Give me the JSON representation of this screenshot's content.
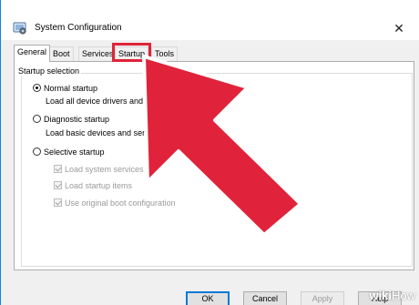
{
  "window": {
    "title": "System Configuration",
    "close_glyph": "✕",
    "icons": {
      "app": "system-config-icon",
      "close": "close-icon"
    }
  },
  "tabs": [
    {
      "label": "General",
      "active": true
    },
    {
      "label": "Boot",
      "active": false
    },
    {
      "label": "Services",
      "active": false
    },
    {
      "label": "Startup",
      "active": false,
      "highlighted": true
    },
    {
      "label": "Tools",
      "active": false
    }
  ],
  "startup_selection": {
    "legend": "Startup selection",
    "options": [
      {
        "label": "Normal startup",
        "description": "Load all device drivers and services",
        "selected": true
      },
      {
        "label": "Diagnostic startup",
        "description": "Load basic devices and services only",
        "selected": false
      },
      {
        "label": "Selective startup",
        "selected": false
      }
    ],
    "selective_checks": [
      {
        "label": "Load system services",
        "checked": true,
        "enabled": false
      },
      {
        "label": "Load startup items",
        "checked": true,
        "enabled": false
      },
      {
        "label": "Use original boot configuration",
        "checked": true,
        "enabled": false
      }
    ]
  },
  "buttons": {
    "ok": "OK",
    "cancel": "Cancel",
    "apply": "Apply",
    "help": "Help"
  },
  "colors": {
    "accent": "#0078d7",
    "highlight": "#e0233a",
    "arrow": "#e0233a"
  },
  "watermark": {
    "wiki": "wiki",
    "how": "How"
  }
}
